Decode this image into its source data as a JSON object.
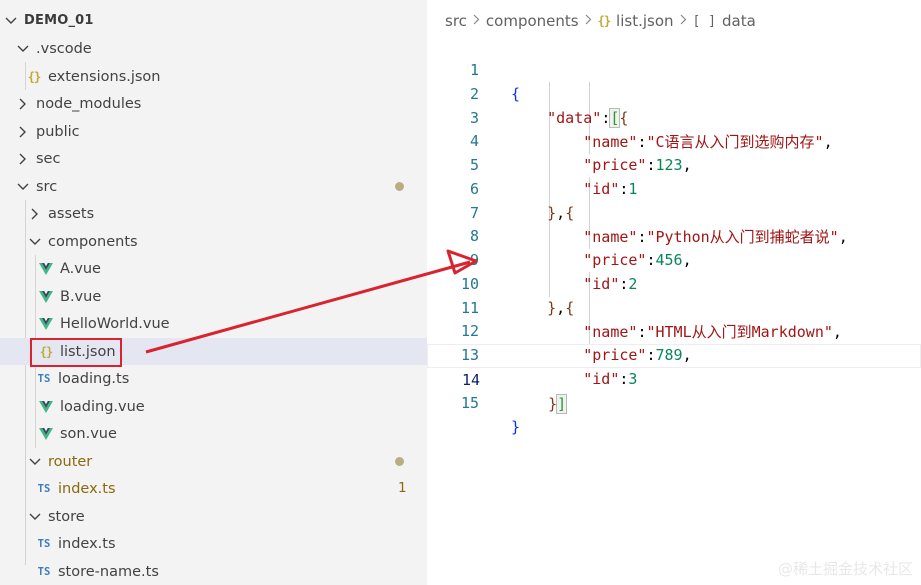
{
  "explorer": {
    "root": "DEMO_01",
    "items": [
      {
        "label": ".vscode",
        "kind": "folder-open"
      },
      {
        "label": "extensions.json",
        "kind": "json"
      },
      {
        "label": "node_modules",
        "kind": "folder"
      },
      {
        "label": "public",
        "kind": "folder"
      },
      {
        "label": "sec",
        "kind": "folder"
      },
      {
        "label": "src",
        "kind": "folder-open"
      },
      {
        "label": "assets",
        "kind": "folder"
      },
      {
        "label": "components",
        "kind": "folder-open"
      },
      {
        "label": "A.vue",
        "kind": "vue"
      },
      {
        "label": "B.vue",
        "kind": "vue"
      },
      {
        "label": "HelloWorld.vue",
        "kind": "vue"
      },
      {
        "label": "list.json",
        "kind": "json"
      },
      {
        "label": "loading.ts",
        "kind": "ts"
      },
      {
        "label": "loading.vue",
        "kind": "vue"
      },
      {
        "label": "son.vue",
        "kind": "vue"
      },
      {
        "label": "router",
        "kind": "folder-open"
      },
      {
        "label": "index.ts",
        "kind": "ts"
      },
      {
        "label": "store",
        "kind": "folder-open"
      },
      {
        "label": "index.ts",
        "kind": "ts"
      },
      {
        "label": "store-name.ts",
        "kind": "ts"
      }
    ],
    "router_index_problems": "1",
    "json_icon_glyph": "{}",
    "ts_icon_glyph": "TS"
  },
  "breadcrumb": {
    "segments": [
      "src",
      "components",
      "list.json",
      "data"
    ],
    "json_glyph": "{}",
    "array_glyph": "[ ]"
  },
  "editor": {
    "line_numbers": [
      "1",
      "2",
      "3",
      "4",
      "5",
      "6",
      "7",
      "8",
      "9",
      "10",
      "11",
      "12",
      "13",
      "14",
      "15"
    ],
    "current_line": "14",
    "key_data": "\"data\"",
    "key_name": "\"name\"",
    "key_price": "\"price\"",
    "key_id": "\"id\"",
    "records": [
      {
        "name": "\"C语言从入门到选购内存\"",
        "price": "123",
        "id": "1"
      },
      {
        "name": "\"Python从入门到捕蛇者说\"",
        "price": "456",
        "id": "2"
      },
      {
        "name": "\"HTML从入门到Markdown\"",
        "price": "789",
        "id": "3"
      }
    ]
  },
  "colors": {
    "sidebar_bg": "#f3f3f3",
    "selection_bg": "#e4e6f1",
    "annotation_red": "#d9232f",
    "vue_green": "#41b883",
    "json_yellow": "#c0aa3b",
    "ts_blue": "#3c7bbf"
  },
  "watermark": "@稀土掘金技术社区"
}
